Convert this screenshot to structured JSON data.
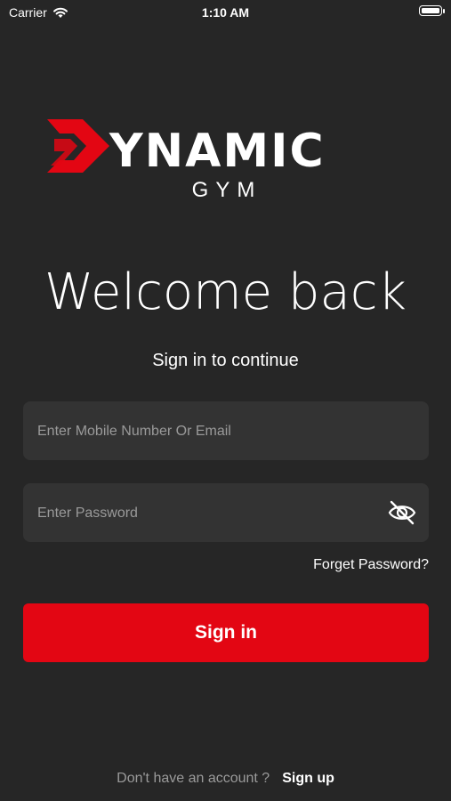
{
  "status_bar": {
    "carrier": "Carrier",
    "time": "1:10 AM"
  },
  "logo": {
    "word": "YNAMIC",
    "sub": "GYM",
    "brand_color": "#e30613"
  },
  "heading": {
    "title": "Welcome back",
    "subtitle": "Sign in to continue"
  },
  "form": {
    "identifier_placeholder": "Enter Mobile Number Or Email",
    "password_placeholder": "Enter Password",
    "forgot_label": "Forget Password?",
    "submit_label": "Sign in"
  },
  "footer": {
    "prompt": "Don't have an account ?",
    "signup_label": "Sign up"
  }
}
